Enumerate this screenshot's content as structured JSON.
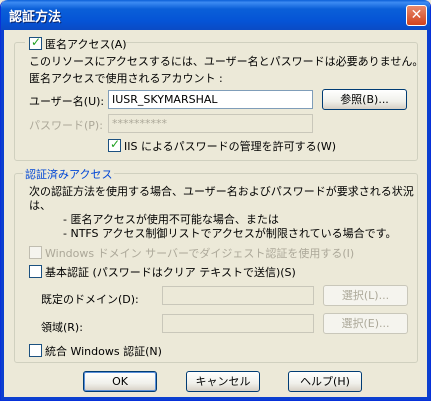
{
  "window": {
    "title": "認証方法",
    "close_label": "✕"
  },
  "anonymous": {
    "checkbox_label": "匿名アクセス(A)",
    "desc": "このリソースにアクセスするには、ユーザー名とパスワードは必要ありません。",
    "account_label": "匿名アクセスで使用されるアカウント :",
    "username_label": "ユーザー名(U):",
    "username_value": "IUSR_SKYMARSHAL",
    "browse_button": "参照(B)...",
    "password_label": "パスワード(P):",
    "password_value": "**********",
    "iis_label": "IIS によるパスワードの管理を許可する(W)"
  },
  "auth": {
    "group_title": "認証済みアクセス",
    "desc_line1": "次の認証方法を使用する場合、ユーザー名およびパスワードが要求される状況",
    "desc_line2": "は、",
    "bullet1": "- 匿名アクセスが使用不可能な場合、または",
    "bullet2": "- NTFS アクセス制御リストでアクセスが制限されている場合です。",
    "digest_label": "Windows ドメイン サーバーでダイジェスト認証を使用する(I)",
    "basic_label": "基本認証 (パスワードはクリア テキストで送信)(S)",
    "domain_label": "既定のドメイン(D):",
    "domain_value": "",
    "domain_select": "選択(L)...",
    "realm_label": "領域(R):",
    "realm_value": "",
    "realm_select": "選択(E)...",
    "integrated_label": "統合 Windows 認証(N)"
  },
  "buttons": {
    "ok": "OK",
    "cancel": "キャンセル",
    "help": "ヘルプ(H)"
  },
  "colors": {
    "titlebar": "#0a5fd8",
    "face": "#ece9d8",
    "group_title": "#0046d5"
  }
}
